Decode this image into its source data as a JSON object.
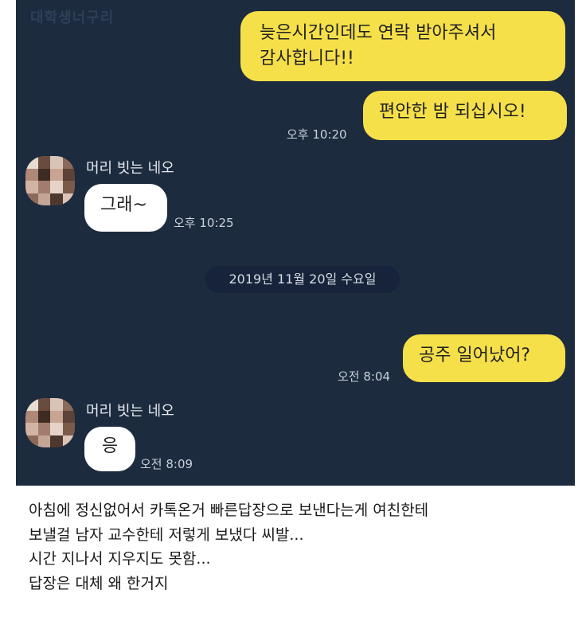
{
  "watermark": "대학생너구리",
  "messages": {
    "m1_line1": "늦은시간인데도 연락 받아주셔서",
    "m1_line2": "감사합니다!!",
    "m2": "편안한 밤 되십시오!",
    "m2_time": "오후 10:20",
    "sender1": "머리 빗는 네오",
    "m3": "그래~",
    "m3_time": "오후 10:25",
    "date_divider": "2019년 11월 20일 수요일",
    "m4": "공주 일어났어?",
    "m4_time": "오전 8:04",
    "sender2": "머리 빗는 네오",
    "m5": "응",
    "m5_time": "오전 8:09"
  },
  "caption": {
    "line1": "아침에 정신없어서 카톡온거 빠른답장으로 보낸다는게 여친한테",
    "line2": "보낼걸 남자 교수한테 저렇게 보냈다 씨발...",
    "line3": "시간 지나서 지우지도 못함...",
    "line4": "답장은 대체 왜 한거지"
  },
  "colors": {
    "chat_background": "#1c2b3e",
    "my_bubble": "#f6e04a",
    "their_bubble": "#ffffff"
  }
}
